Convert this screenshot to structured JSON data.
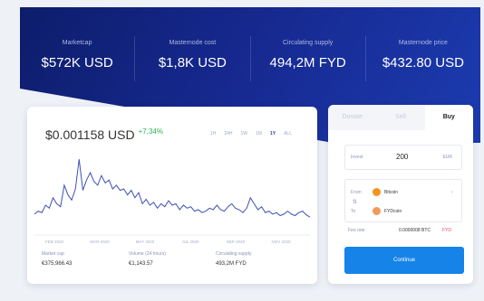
{
  "stats": [
    {
      "label": "Marketcap",
      "value": "$572K USD"
    },
    {
      "label": "Masternode cost",
      "value": "$1,8K USD"
    },
    {
      "label": "Circulating supply",
      "value": "494,2M FYD"
    },
    {
      "label": "Masternode price",
      "value": "$432.80 USD"
    }
  ],
  "chart_card": {
    "price": "$0.001158 USD",
    "change": "+7,34%",
    "ranges": [
      "1H",
      "24H",
      "1W",
      "1M",
      "1Y",
      "ALL"
    ],
    "active_range": "1Y",
    "footer": [
      {
        "label": "Market cap",
        "value": "€375,966.43"
      },
      {
        "label": "Volume (24 hours)",
        "value": "€1,143.57"
      },
      {
        "label": "Circulating supply",
        "value": "493,2M FYD"
      }
    ]
  },
  "chart_data": {
    "type": "line",
    "title": "",
    "xlabel": "",
    "ylabel": "",
    "x_ticks": [
      "FEB 2020",
      "MAR 2020",
      "MAY 2020",
      "JUL 2020",
      "SEP 2020",
      "NOV 2020"
    ],
    "series": [
      {
        "values": [
          0.16,
          0.2,
          0.18,
          0.28,
          0.24,
          0.38,
          0.3,
          0.26,
          0.55,
          0.42,
          0.35,
          0.5,
          0.9,
          0.48,
          0.62,
          0.72,
          0.6,
          0.55,
          0.68,
          0.58,
          0.62,
          0.5,
          0.55,
          0.48,
          0.5,
          0.42,
          0.48,
          0.38,
          0.45,
          0.3,
          0.36,
          0.28,
          0.32,
          0.24,
          0.3,
          0.26,
          0.34,
          0.28,
          0.3,
          0.22,
          0.28,
          0.24,
          0.26,
          0.2,
          0.22,
          0.18,
          0.2,
          0.24,
          0.22,
          0.28,
          0.22,
          0.2,
          0.26,
          0.3,
          0.24,
          0.22,
          0.18,
          0.24,
          0.38,
          0.3,
          0.22,
          0.26,
          0.18,
          0.2,
          0.16,
          0.18,
          0.14,
          0.16,
          0.2,
          0.16,
          0.14,
          0.18,
          0.2,
          0.15,
          0.12
        ]
      }
    ],
    "grid": false,
    "color": "#3f51b5"
  },
  "trade": {
    "tabs": [
      "Donate",
      "Sell",
      "Buy"
    ],
    "active_tab": "Buy",
    "amount_label": "Invest",
    "amount_value": "200",
    "amount_unit": "EUR",
    "from_label": "From",
    "from_coin": "Bitcoin",
    "to_label": "To",
    "to_coin": "FYDcoin",
    "rate_label": "Fee rate",
    "rate_value": "0.0000008 BTC",
    "rate_note": "FYD",
    "continue_label": "Continue"
  }
}
